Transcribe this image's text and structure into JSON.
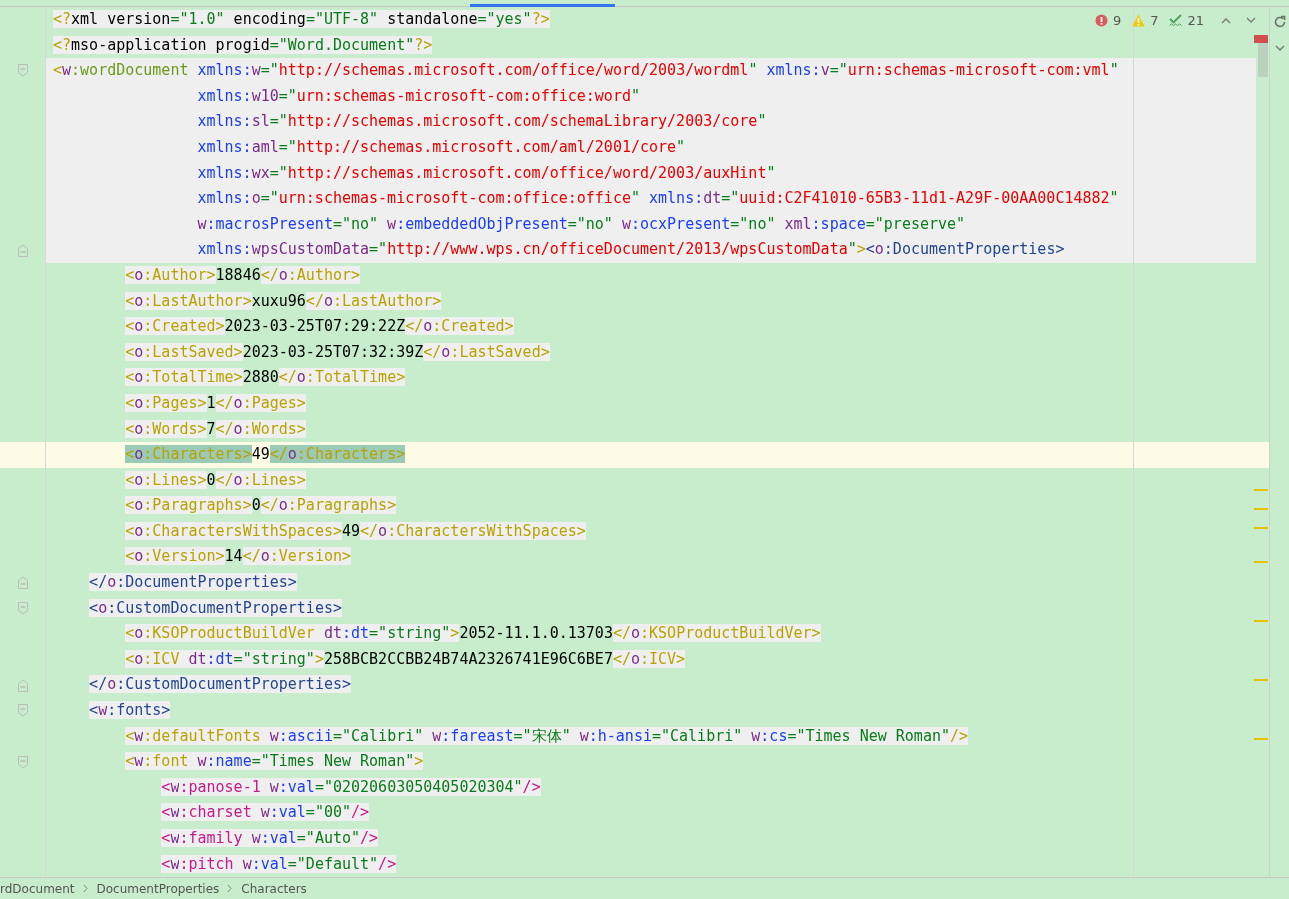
{
  "inspections": [
    {
      "kind": "error",
      "count": "9"
    },
    {
      "kind": "warning",
      "count": "7"
    },
    {
      "kind": "typo",
      "count": "21"
    }
  ],
  "lines": [
    {
      "kind": "code",
      "tokens": [
        {
          "kind": "olive",
          "text": "<?"
        },
        {
          "kind": "plain",
          "text": "xml version"
        },
        {
          "kind": "string",
          "text": "=\"1.0\""
        },
        {
          "kind": "plain",
          "text": " encoding"
        },
        {
          "kind": "string",
          "text": "=\"UTF-8\""
        },
        {
          "kind": "plain",
          "text": " standalone"
        },
        {
          "kind": "string",
          "text": "=\"yes\""
        },
        {
          "kind": "olive",
          "text": "?>"
        }
      ]
    },
    {
      "kind": "code",
      "tokens": [
        {
          "kind": "olive",
          "text": "<?"
        },
        {
          "kind": "plain",
          "text": "mso-application progid"
        },
        {
          "kind": "string",
          "text": "=\"Word.Document\""
        },
        {
          "kind": "olive",
          "text": "?>"
        }
      ]
    },
    {
      "kind": "code",
      "fold_start": true,
      "block": true,
      "tokens": [
        {
          "kind": "olive",
          "text": "<"
        },
        {
          "kind": "prefix",
          "text": "w"
        },
        {
          "kind": "lime",
          "text": ":wordDocument"
        },
        {
          "kind": "attr",
          "text": " xmlns:"
        },
        {
          "kind": "prefix",
          "text": "w"
        },
        {
          "kind": "string",
          "text": "=\""
        },
        {
          "kind": "url",
          "text": "http://schemas.microsoft.com/office/word/2003/wordml"
        },
        {
          "kind": "string",
          "text": "\""
        },
        {
          "kind": "attr",
          "text": " xmlns:"
        },
        {
          "kind": "prefix",
          "text": "v"
        },
        {
          "kind": "string",
          "text": "=\""
        },
        {
          "kind": "url",
          "text": "urn:schemas-microsoft-com:vml"
        },
        {
          "kind": "string",
          "text": "\""
        }
      ],
      "children": [
        {
          "kind": "continuation",
          "block": true,
          "tokens": [
            {
              "kind": "attr",
              "text": "xmlns:"
            },
            {
              "kind": "prefix",
              "text": "w10"
            },
            {
              "kind": "string",
              "text": "=\""
            },
            {
              "kind": "url",
              "text": "urn:schemas-microsoft-com:office:word"
            },
            {
              "kind": "string",
              "text": "\""
            }
          ]
        },
        {
          "kind": "continuation",
          "block": true,
          "tokens": [
            {
              "kind": "attr",
              "text": "xmlns:"
            },
            {
              "kind": "prefix",
              "text": "sl"
            },
            {
              "kind": "string",
              "text": "=\""
            },
            {
              "kind": "url",
              "text": "http://schemas.microsoft.com/schemaLibrary/2003/core"
            },
            {
              "kind": "string",
              "text": "\""
            }
          ]
        },
        {
          "kind": "continuation",
          "block": true,
          "tokens": [
            {
              "kind": "attr",
              "text": "xmlns:"
            },
            {
              "kind": "prefix",
              "text": "aml"
            },
            {
              "kind": "string",
              "text": "=\""
            },
            {
              "kind": "url",
              "text": "http://schemas.microsoft.com/aml/2001/core"
            },
            {
              "kind": "string",
              "text": "\""
            }
          ]
        },
        {
          "kind": "continuation",
          "block": true,
          "tokens": [
            {
              "kind": "attr",
              "text": "xmlns:"
            },
            {
              "kind": "prefix",
              "text": "wx"
            },
            {
              "kind": "string",
              "text": "=\""
            },
            {
              "kind": "url",
              "text": "http://schemas.microsoft.com/office/word/2003/auxHint"
            },
            {
              "kind": "string",
              "text": "\""
            }
          ]
        },
        {
          "kind": "continuation",
          "block": true,
          "tokens": [
            {
              "kind": "attr",
              "text": "xmlns:"
            },
            {
              "kind": "prefix",
              "text": "o"
            },
            {
              "kind": "string",
              "text": "=\""
            },
            {
              "kind": "url",
              "text": "urn:schemas-microsoft-com:office:office"
            },
            {
              "kind": "string",
              "text": "\""
            },
            {
              "kind": "attr",
              "text": " xmlns:"
            },
            {
              "kind": "prefix",
              "text": "dt"
            },
            {
              "kind": "string",
              "text": "=\""
            },
            {
              "kind": "url",
              "text": "uuid:C2F41010-65B3-11d1-A29F-00AA00C14882"
            },
            {
              "kind": "string",
              "text": "\""
            }
          ]
        },
        {
          "kind": "continuation",
          "block": true,
          "tokens": [
            {
              "kind": "prefix",
              "text": "w"
            },
            {
              "kind": "attr",
              "text": ":macrosPresent"
            },
            {
              "kind": "string",
              "text": "=\"no\""
            },
            {
              "kind": "prefix",
              "text": " w"
            },
            {
              "kind": "attr",
              "text": ":embeddedObjPresent"
            },
            {
              "kind": "string",
              "text": "=\"no\""
            },
            {
              "kind": "prefix",
              "text": " w"
            },
            {
              "kind": "attr",
              "text": ":ocxPresent"
            },
            {
              "kind": "string",
              "text": "=\"no\""
            },
            {
              "kind": "prefix",
              "text": " xml"
            },
            {
              "kind": "attr",
              "text": ":space"
            },
            {
              "kind": "string",
              "text": "=\"preserve\""
            }
          ]
        },
        {
          "kind": "continuation",
          "fold_end": true,
          "block": true,
          "tokens": [
            {
              "kind": "attr",
              "text": "xmlns:"
            },
            {
              "kind": "prefix",
              "text": "wpsCustomData"
            },
            {
              "kind": "string",
              "text": "=\""
            },
            {
              "kind": "url",
              "text": "http://www.wps.cn/officeDocument/2013/wpsCustomData"
            },
            {
              "kind": "string",
              "text": "\""
            },
            {
              "kind": "olive",
              "text": ">"
            },
            {
              "kind": "navy",
              "text": "<"
            },
            {
              "kind": "prefix",
              "text": "o"
            },
            {
              "kind": "navy",
              "text": ":DocumentProperties>"
            }
          ],
          "children": [
            {
              "kind": "code",
              "tokens": [
                {
                  "kind": "olive",
                  "text": "<"
                },
                {
                  "kind": "prefix",
                  "text": "o"
                },
                {
                  "kind": "olive",
                  "text": ":Author>"
                },
                {
                  "kind": "content",
                  "text": "18846"
                },
                {
                  "kind": "olive",
                  "text": "</"
                },
                {
                  "kind": "prefix",
                  "text": "o"
                },
                {
                  "kind": "olive",
                  "text": ":Author>"
                }
              ]
            },
            {
              "kind": "code",
              "tokens": [
                {
                  "kind": "olive",
                  "text": "<"
                },
                {
                  "kind": "prefix",
                  "text": "o"
                },
                {
                  "kind": "olive",
                  "text": ":LastAuthor>"
                },
                {
                  "kind": "content",
                  "text": "xuxu96"
                },
                {
                  "kind": "olive",
                  "text": "</"
                },
                {
                  "kind": "prefix",
                  "text": "o"
                },
                {
                  "kind": "olive",
                  "text": ":LastAuthor>"
                }
              ]
            },
            {
              "kind": "code",
              "tokens": [
                {
                  "kind": "olive",
                  "text": "<"
                },
                {
                  "kind": "prefix",
                  "text": "o"
                },
                {
                  "kind": "olive",
                  "text": ":Created>"
                },
                {
                  "kind": "content",
                  "text": "2023-03-25T07:29:22Z"
                },
                {
                  "kind": "olive",
                  "text": "</"
                },
                {
                  "kind": "prefix",
                  "text": "o"
                },
                {
                  "kind": "olive",
                  "text": ":Created>"
                }
              ]
            },
            {
              "kind": "code",
              "tokens": [
                {
                  "kind": "olive",
                  "text": "<"
                },
                {
                  "kind": "prefix",
                  "text": "o"
                },
                {
                  "kind": "olive",
                  "text": ":LastSaved>"
                },
                {
                  "kind": "content",
                  "text": "2023-03-25T07:32:39Z"
                },
                {
                  "kind": "olive",
                  "text": "</"
                },
                {
                  "kind": "prefix",
                  "text": "o"
                },
                {
                  "kind": "olive",
                  "text": ":LastSaved>"
                }
              ]
            },
            {
              "kind": "code",
              "tokens": [
                {
                  "kind": "olive",
                  "text": "<"
                },
                {
                  "kind": "prefix",
                  "text": "o"
                },
                {
                  "kind": "olive",
                  "text": ":TotalTime>"
                },
                {
                  "kind": "content",
                  "text": "2880"
                },
                {
                  "kind": "olive",
                  "text": "</"
                },
                {
                  "kind": "prefix",
                  "text": "o"
                },
                {
                  "kind": "olive",
                  "text": ":TotalTime>"
                }
              ]
            },
            {
              "kind": "code",
              "tokens": [
                {
                  "kind": "olive",
                  "text": "<"
                },
                {
                  "kind": "prefix",
                  "text": "o"
                },
                {
                  "kind": "olive",
                  "text": ":Pages>"
                },
                {
                  "kind": "content",
                  "text": "1"
                },
                {
                  "kind": "olive",
                  "text": "</"
                },
                {
                  "kind": "prefix",
                  "text": "o"
                },
                {
                  "kind": "olive",
                  "text": ":Pages>"
                }
              ]
            },
            {
              "kind": "code",
              "tokens": [
                {
                  "kind": "olive",
                  "text": "<"
                },
                {
                  "kind": "prefix",
                  "text": "o"
                },
                {
                  "kind": "olive",
                  "text": ":Words>"
                },
                {
                  "kind": "content",
                  "text": "7"
                },
                {
                  "kind": "olive",
                  "text": "</"
                },
                {
                  "kind": "prefix",
                  "text": "o"
                },
                {
                  "kind": "olive",
                  "text": ":Words>"
                }
              ]
            },
            {
              "kind": "code",
              "current": true,
              "tokens": [
                {
                  "kind": "olive",
                  "text": "<",
                  "match": true
                },
                {
                  "kind": "prefix",
                  "text": "o",
                  "match": true
                },
                {
                  "kind": "olive",
                  "text": ":Characters>",
                  "match": true
                },
                {
                  "kind": "content",
                  "text": "49"
                },
                {
                  "kind": "olive",
                  "text": "</",
                  "match": true
                },
                {
                  "kind": "prefix",
                  "text": "o",
                  "match": true
                },
                {
                  "kind": "olive",
                  "text": ":Characters>",
                  "match": true
                }
              ]
            },
            {
              "kind": "code",
              "tokens": [
                {
                  "kind": "olive",
                  "text": "<"
                },
                {
                  "kind": "prefix",
                  "text": "o"
                },
                {
                  "kind": "olive",
                  "text": ":Lines>"
                },
                {
                  "kind": "content",
                  "text": "0"
                },
                {
                  "kind": "olive",
                  "text": "</"
                },
                {
                  "kind": "prefix",
                  "text": "o"
                },
                {
                  "kind": "olive",
                  "text": ":Lines>"
                }
              ]
            },
            {
              "kind": "code",
              "tokens": [
                {
                  "kind": "olive",
                  "text": "<"
                },
                {
                  "kind": "prefix",
                  "text": "o"
                },
                {
                  "kind": "olive",
                  "text": ":Paragraphs>"
                },
                {
                  "kind": "content",
                  "text": "0"
                },
                {
                  "kind": "olive",
                  "text": "</"
                },
                {
                  "kind": "prefix",
                  "text": "o"
                },
                {
                  "kind": "olive",
                  "text": ":Paragraphs>"
                }
              ]
            },
            {
              "kind": "code",
              "tokens": [
                {
                  "kind": "olive",
                  "text": "<"
                },
                {
                  "kind": "prefix",
                  "text": "o"
                },
                {
                  "kind": "olive",
                  "text": ":CharactersWithSpaces>"
                },
                {
                  "kind": "content",
                  "text": "49"
                },
                {
                  "kind": "olive",
                  "text": "</"
                },
                {
                  "kind": "prefix",
                  "text": "o"
                },
                {
                  "kind": "olive",
                  "text": ":CharactersWithSpaces>"
                }
              ]
            },
            {
              "kind": "code",
              "tokens": [
                {
                  "kind": "olive",
                  "text": "<"
                },
                {
                  "kind": "prefix",
                  "text": "o"
                },
                {
                  "kind": "olive",
                  "text": ":Version>"
                },
                {
                  "kind": "content",
                  "text": "14"
                },
                {
                  "kind": "olive",
                  "text": "</"
                },
                {
                  "kind": "prefix",
                  "text": "o"
                },
                {
                  "kind": "olive",
                  "text": ":Version>"
                }
              ]
            }
          ]
        },
        {
          "kind": "code",
          "fold_end": true,
          "tokens": [
            {
              "kind": "navy",
              "text": "</"
            },
            {
              "kind": "prefix",
              "text": "o"
            },
            {
              "kind": "navy",
              "text": ":DocumentProperties>"
            }
          ]
        },
        {
          "kind": "code",
          "fold_start": true,
          "tokens": [
            {
              "kind": "navy",
              "text": "<"
            },
            {
              "kind": "prefix",
              "text": "o"
            },
            {
              "kind": "navy",
              "text": ":CustomDocumentProperties>"
            }
          ],
          "children": [
            {
              "kind": "code",
              "tokens": [
                {
                  "kind": "olive",
                  "text": "<"
                },
                {
                  "kind": "prefix",
                  "text": "o"
                },
                {
                  "kind": "olive",
                  "text": ":KSOProductBuildVer"
                },
                {
                  "kind": "prefix",
                  "text": " dt"
                },
                {
                  "kind": "attr",
                  "text": ":dt"
                },
                {
                  "kind": "string",
                  "text": "=\"string\""
                },
                {
                  "kind": "olive",
                  "text": ">"
                },
                {
                  "kind": "content",
                  "text": "2052-11.1.0.13703"
                },
                {
                  "kind": "olive",
                  "text": "</"
                },
                {
                  "kind": "prefix",
                  "text": "o"
                },
                {
                  "kind": "olive",
                  "text": ":KSOProductBuildVer>"
                }
              ]
            },
            {
              "kind": "code",
              "tokens": [
                {
                  "kind": "olive",
                  "text": "<"
                },
                {
                  "kind": "prefix",
                  "text": "o"
                },
                {
                  "kind": "olive",
                  "text": ":ICV"
                },
                {
                  "kind": "prefix",
                  "text": " dt"
                },
                {
                  "kind": "attr",
                  "text": ":dt"
                },
                {
                  "kind": "string",
                  "text": "=\"string\""
                },
                {
                  "kind": "olive",
                  "text": ">"
                },
                {
                  "kind": "content",
                  "text": "258BCB2CCBB24B74A2326741E96C6BE7"
                },
                {
                  "kind": "olive",
                  "text": "</"
                },
                {
                  "kind": "prefix",
                  "text": "o"
                },
                {
                  "kind": "olive",
                  "text": ":ICV>"
                }
              ]
            }
          ]
        },
        {
          "kind": "code",
          "fold_end": true,
          "tokens": [
            {
              "kind": "navy",
              "text": "</"
            },
            {
              "kind": "prefix",
              "text": "o"
            },
            {
              "kind": "navy",
              "text": ":CustomDocumentProperties>"
            }
          ]
        },
        {
          "kind": "code",
          "fold_start": true,
          "tokens": [
            {
              "kind": "navy",
              "text": "<"
            },
            {
              "kind": "prefix",
              "text": "w"
            },
            {
              "kind": "navy",
              "text": ":fonts>"
            }
          ],
          "children": [
            {
              "kind": "code",
              "tokens": [
                {
                  "kind": "olive",
                  "text": "<"
                },
                {
                  "kind": "prefix",
                  "text": "w"
                },
                {
                  "kind": "olive",
                  "text": ":defaultFonts"
                },
                {
                  "kind": "prefix",
                  "text": " w"
                },
                {
                  "kind": "attr",
                  "text": ":ascii"
                },
                {
                  "kind": "string",
                  "text": "=\"Calibri\""
                },
                {
                  "kind": "prefix",
                  "text": " w"
                },
                {
                  "kind": "attr",
                  "text": ":fareast"
                },
                {
                  "kind": "string",
                  "text": "=\"宋体\""
                },
                {
                  "kind": "prefix",
                  "text": " w"
                },
                {
                  "kind": "attr",
                  "text": ":h-ansi"
                },
                {
                  "kind": "string",
                  "text": "=\"Calibri\""
                },
                {
                  "kind": "prefix",
                  "text": " w"
                },
                {
                  "kind": "attr",
                  "text": ":cs"
                },
                {
                  "kind": "string",
                  "text": "=\"Times New Roman\""
                },
                {
                  "kind": "olive",
                  "text": "/>"
                }
              ]
            },
            {
              "kind": "code",
              "fold_start": true,
              "tokens": [
                {
                  "kind": "olive",
                  "text": "<"
                },
                {
                  "kind": "prefix",
                  "text": "w"
                },
                {
                  "kind": "olive",
                  "text": ":font"
                },
                {
                  "kind": "prefix",
                  "text": " w"
                },
                {
                  "kind": "attr",
                  "text": ":name"
                },
                {
                  "kind": "string",
                  "text": "=\"Times New Roman\""
                },
                {
                  "kind": "olive",
                  "text": ">"
                }
              ],
              "children": [
                {
                  "kind": "code",
                  "tokens": [
                    {
                      "kind": "magenta",
                      "text": "<"
                    },
                    {
                      "kind": "prefix",
                      "text": "w"
                    },
                    {
                      "kind": "magenta",
                      "text": ":panose-1"
                    },
                    {
                      "kind": "prefix",
                      "text": " w"
                    },
                    {
                      "kind": "attr",
                      "text": ":val"
                    },
                    {
                      "kind": "string",
                      "text": "=\"02020603050405020304\""
                    },
                    {
                      "kind": "magenta",
                      "text": "/>"
                    }
                  ]
                },
                {
                  "kind": "code",
                  "tokens": [
                    {
                      "kind": "magenta",
                      "text": "<"
                    },
                    {
                      "kind": "prefix",
                      "text": "w"
                    },
                    {
                      "kind": "magenta",
                      "text": ":charset"
                    },
                    {
                      "kind": "prefix",
                      "text": " w"
                    },
                    {
                      "kind": "attr",
                      "text": ":val"
                    },
                    {
                      "kind": "string",
                      "text": "=\"00\""
                    },
                    {
                      "kind": "magenta",
                      "text": "/>"
                    }
                  ]
                },
                {
                  "kind": "code",
                  "tokens": [
                    {
                      "kind": "magenta",
                      "text": "<"
                    },
                    {
                      "kind": "prefix",
                      "text": "w"
                    },
                    {
                      "kind": "magenta",
                      "text": ":family"
                    },
                    {
                      "kind": "prefix",
                      "text": " w"
                    },
                    {
                      "kind": "attr",
                      "text": ":val"
                    },
                    {
                      "kind": "string",
                      "text": "=\"Auto\""
                    },
                    {
                      "kind": "magenta",
                      "text": "/>"
                    }
                  ]
                },
                {
                  "kind": "code",
                  "tokens": [
                    {
                      "kind": "magenta",
                      "text": "<"
                    },
                    {
                      "kind": "prefix",
                      "text": "w"
                    },
                    {
                      "kind": "magenta",
                      "text": ":pitch"
                    },
                    {
                      "kind": "prefix",
                      "text": " w"
                    },
                    {
                      "kind": "attr",
                      "text": ":val"
                    },
                    {
                      "kind": "string",
                      "text": "=\"Default\""
                    },
                    {
                      "kind": "magenta",
                      "text": "/>"
                    }
                  ]
                }
              ]
            }
          ]
        }
      ]
    }
  ],
  "breadcrumb": [
    "rdDocument",
    "DocumentProperties",
    "Characters"
  ]
}
